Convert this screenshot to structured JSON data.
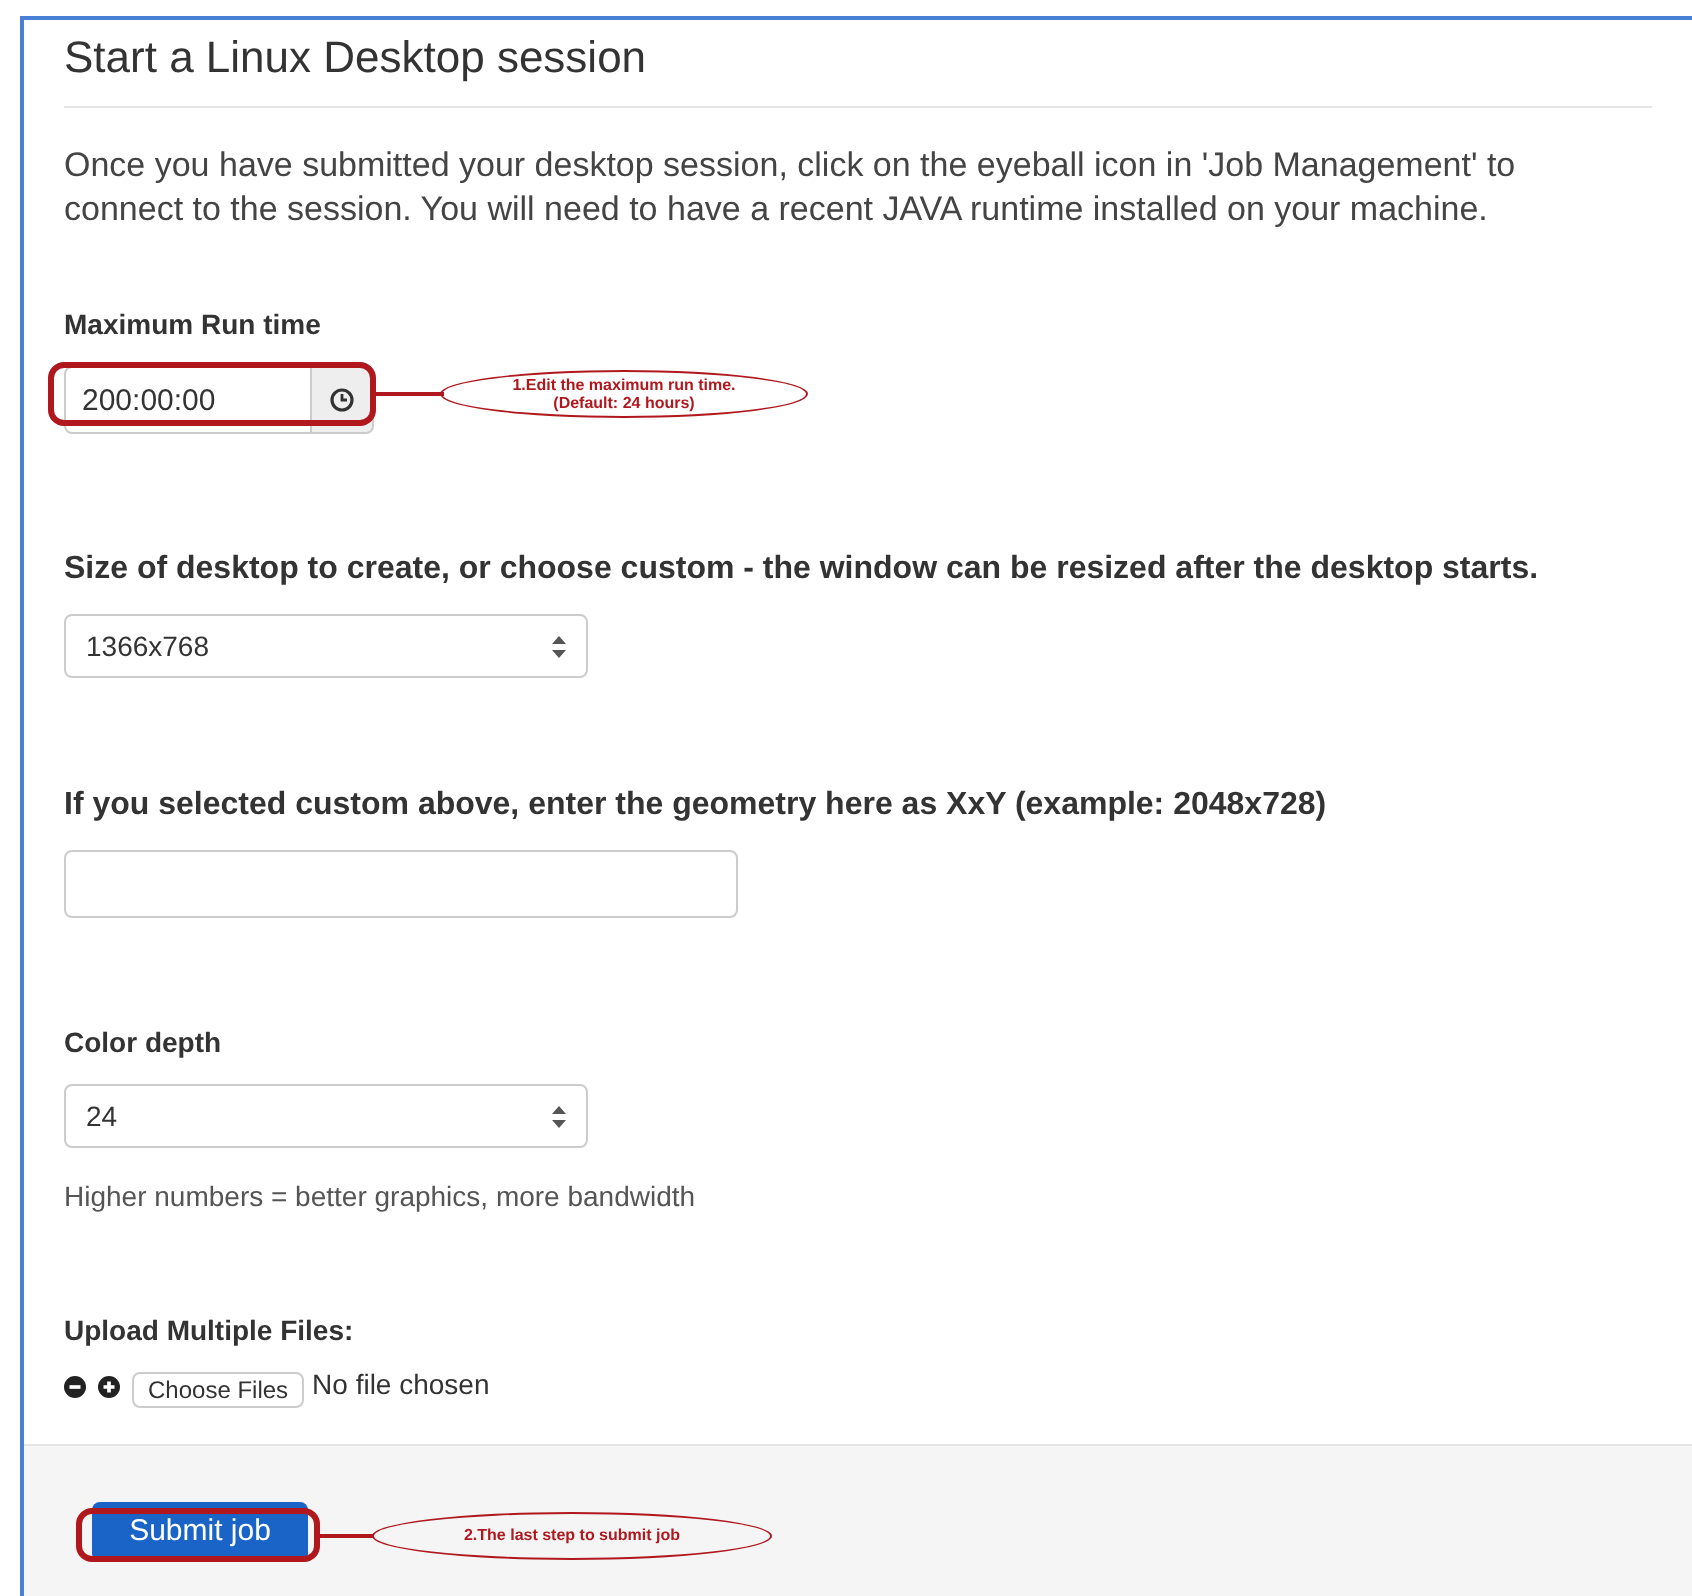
{
  "title": "Start a Linux Desktop session",
  "intro": "Once you have submitted your desktop session, click on the eyeball icon in 'Job Management' to connect to the session. You will need to have a recent JAVA runtime installed on your machine.",
  "run_time": {
    "label": "Maximum Run time",
    "value": "200:00:00",
    "annotation": [
      "1.Edit the maximum run time.",
      "(Default: 24 hours)"
    ]
  },
  "size": {
    "label": "Size of desktop to create, or choose custom - the window can be resized after the desktop starts.",
    "value": "1366x768"
  },
  "custom": {
    "label": "If you selected custom above, enter the geometry here as XxY (example: 2048x728)"
  },
  "color_depth": {
    "label": "Color depth",
    "value": "24",
    "help": "Higher numbers = better graphics, more bandwidth"
  },
  "upload": {
    "label": "Upload Multiple Files:",
    "button": "Choose Files",
    "status": "No file chosen"
  },
  "submit": {
    "label": "Submit job",
    "annotation": "2.The last step to submit job"
  }
}
